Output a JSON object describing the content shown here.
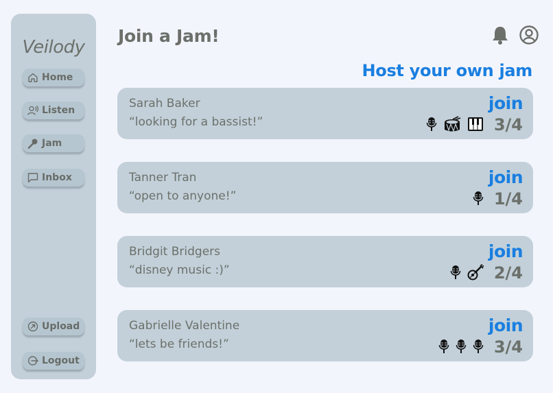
{
  "app": {
    "name": "Veilody"
  },
  "header": {
    "title": "Join a Jam!"
  },
  "sidebar": {
    "items": [
      {
        "label": "Home",
        "icon": "home-icon"
      },
      {
        "label": "Listen",
        "icon": "listen-icon"
      },
      {
        "label": "Jam",
        "icon": "microphone-icon"
      },
      {
        "label": "Inbox",
        "icon": "chat-bubble-icon"
      }
    ],
    "bottom_items": [
      {
        "label": "Upload",
        "icon": "upload-icon"
      },
      {
        "label": "Logout",
        "icon": "logout-icon"
      }
    ]
  },
  "host_link": "Host your own jam",
  "colors": {
    "accent": "#1a7fe0",
    "panel": "#c3d0d9",
    "text": "#6b706b",
    "background": "#f3f5fc"
  },
  "jams": [
    {
      "host": "Sarah Baker",
      "note": "“looking for a bassist!”",
      "join_label": "join",
      "count": "3/4",
      "instruments": [
        "microphone-icon",
        "drum-icon",
        "piano-icon"
      ]
    },
    {
      "host": "Tanner Tran",
      "note": "“open to anyone!”",
      "join_label": "join",
      "count": "1/4",
      "instruments": [
        "microphone-icon"
      ]
    },
    {
      "host": "Bridgit Bridgers",
      "note": "“disney music :)”",
      "join_label": "join",
      "count": "2/4",
      "instruments": [
        "microphone-icon",
        "guitar-icon"
      ]
    },
    {
      "host": "Gabrielle Valentine",
      "note": "“lets be friends!”",
      "join_label": "join",
      "count": "3/4",
      "instruments": [
        "microphone-icon",
        "microphone-icon",
        "microphone-icon"
      ]
    }
  ]
}
